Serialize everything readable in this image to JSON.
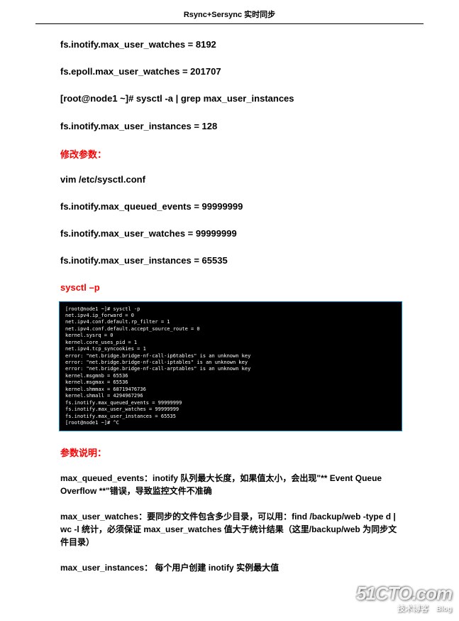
{
  "header": {
    "title": "Rsync+Sersync 实时同步"
  },
  "lines": {
    "l1": "fs.inotify.max_user_watches = 8192",
    "l2": "fs.epoll.max_user_watches = 201707",
    "l3": "[root@node1 ~]# sysctl -a | grep max_user_instances",
    "l4": "fs.inotify.max_user_instances = 128",
    "h1": "修改参数：",
    "l5": "vim /etc/sysctl.conf",
    "l6": "fs.inotify.max_queued_events = 99999999",
    "l7": "fs.inotify.max_user_watches = 99999999",
    "l8": "fs.inotify.max_user_instances = 65535",
    "h2": "sysctl –p",
    "h3": "参数说明：",
    "p1": "max_queued_events：inotify 队列最大长度，如果值太小，会出现\"** Event Queue Overflow **\"错误，导致监控文件不准确",
    "p2": "max_user_watches：要同步的文件包含多少目录，可以用：find /backup/web -type d | wc -l  统计，必须保证 max_user_watches 值大于统计结果（这里/backup/web 为同步文件目录）",
    "p3": "max_user_instances： 每个用户创建 inotify 实例最大值"
  },
  "terminal": {
    "t0": "[root@node1 ~]# sysctl -p",
    "t1": "net.ipv4.ip_forward = 0",
    "t2": "net.ipv4.conf.default.rp_filter = 1",
    "t3": "net.ipv4.conf.default.accept_source_route = 0",
    "t4": "kernel.sysrq = 0",
    "t5": "kernel.core_uses_pid = 1",
    "t6": "net.ipv4.tcp_syncookies = 1",
    "t7": "error: \"net.bridge.bridge-nf-call-ip6tables\" is an unknown key",
    "t8": "error: \"net.bridge.bridge-nf-call-iptables\" is an unknown key",
    "t9": "error: \"net.bridge.bridge-nf-call-arptables\" is an unknown key",
    "t10": "kernel.msgmnb = 65536",
    "t11": "kernel.msgmax = 65536",
    "t12": "kernel.shmmax = 68719476736",
    "t13": "kernel.shmall = 4294967296",
    "t14": "fs.inotify.max_queued_events = 99999999",
    "t15": "fs.inotify.max_user_watches = 99999999",
    "t16": "fs.inotify.max_user_instances = 65535",
    "t17": "[root@node1 ~]# ^C"
  },
  "watermark": {
    "main": "51CTO.com",
    "sub": "技术博客",
    "blog": "Blog"
  }
}
